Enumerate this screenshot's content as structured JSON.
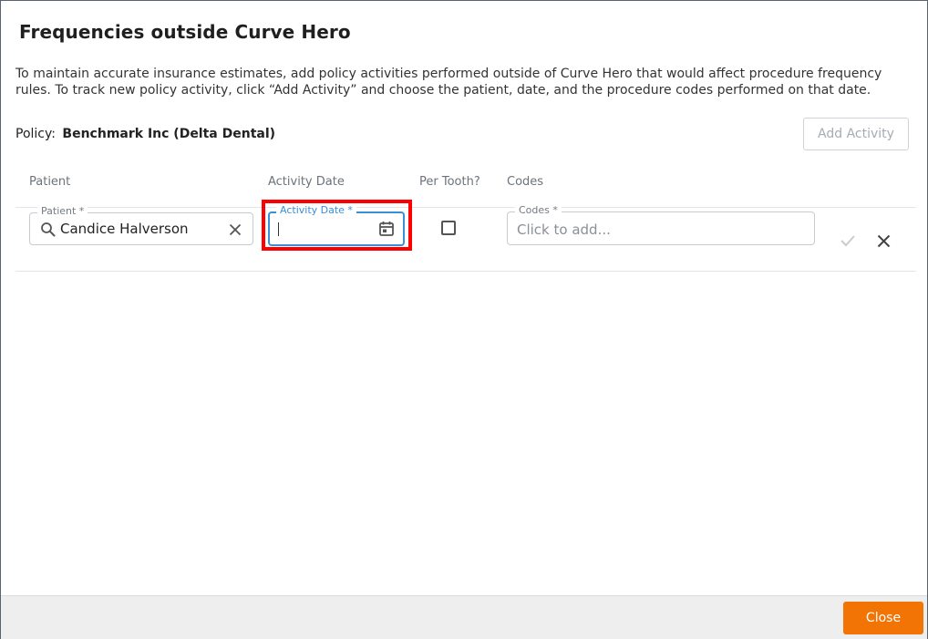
{
  "dialog": {
    "title": "Frequencies outside Curve Hero",
    "description": "To maintain accurate insurance estimates, add policy activities performed outside of Curve Hero that would affect procedure frequency rules. To track new policy activity, click “Add Activity” and choose the patient, date, and the procedure codes performed on that date.",
    "policy_label": "Policy:",
    "policy_name": "Benchmark Inc (Delta Dental)",
    "add_activity_label": "Add Activity"
  },
  "table": {
    "headers": {
      "patient": "Patient",
      "activity_date": "Activity Date",
      "per_tooth": "Per Tooth?",
      "codes": "Codes"
    },
    "row": {
      "patient_label": "Patient *",
      "patient_value": "Candice Halverson",
      "activity_date_label": "Activity Date *",
      "activity_date_value": "",
      "per_tooth_checked": false,
      "codes_label": "Codes *",
      "codes_placeholder": "Click to add..."
    }
  },
  "footer": {
    "close_label": "Close"
  },
  "icons": {
    "search": "search-icon",
    "clear": "close-icon",
    "calendar": "calendar-icon",
    "confirm": "check-icon",
    "remove": "close-icon"
  },
  "colors": {
    "accent": "#f27405",
    "focus": "#3a8fd9",
    "highlight": "#ff0000"
  }
}
